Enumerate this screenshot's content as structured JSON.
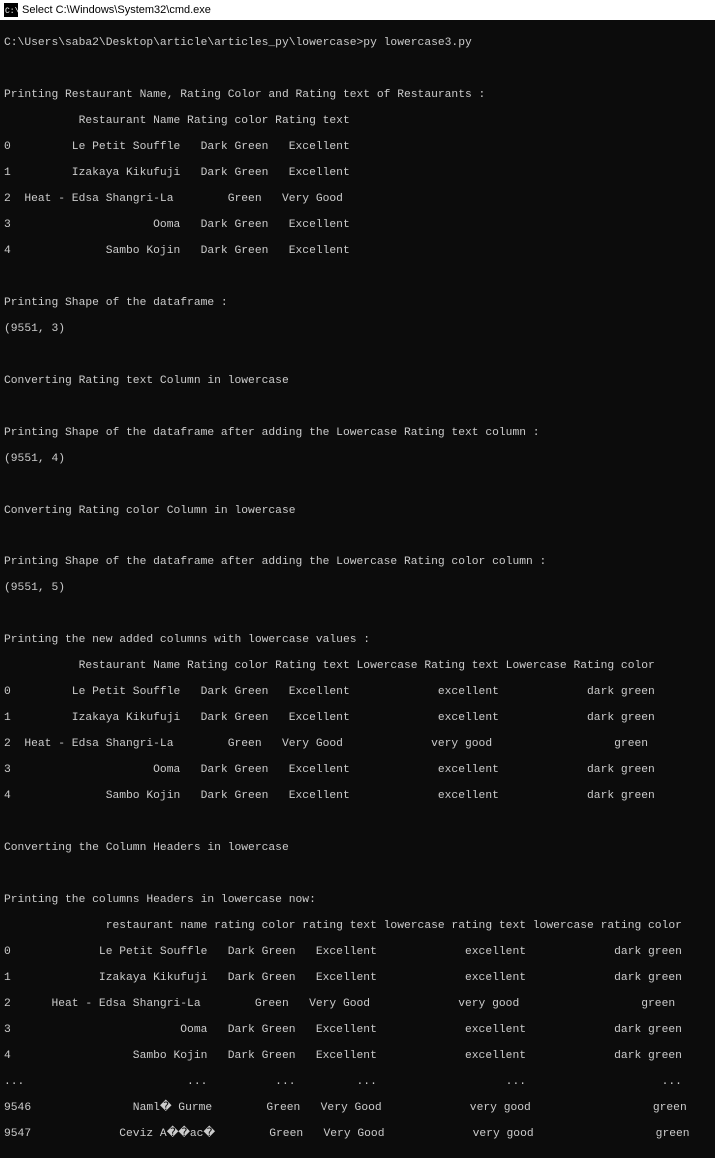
{
  "title_bar": {
    "icon": "cmd-icon",
    "title": "Select C:\\Windows\\System32\\cmd.exe"
  },
  "lines": {
    "l0": "C:\\Users\\saba2\\Desktop\\article\\articles_py\\lowercase>py lowercase3.py",
    "l1": "Printing Restaurant Name, Rating Color and Rating text of Restaurants :",
    "l2": "           Restaurant Name Rating color Rating text",
    "l3": "0         Le Petit Souffle   Dark Green   Excellent",
    "l4": "1         Izakaya Kikufuji   Dark Green   Excellent",
    "l5": "2  Heat - Edsa Shangri-La        Green   Very Good",
    "l6": "3                     Ooma   Dark Green   Excellent",
    "l7": "4              Sambo Kojin   Dark Green   Excellent",
    "l8": "Printing Shape of the dataframe :",
    "l9": "(9551, 3)",
    "l10": "Converting Rating text Column in lowercase",
    "l11": "Printing Shape of the dataframe after adding the Lowercase Rating text column :",
    "l12": "(9551, 4)",
    "l13": "Converting Rating color Column in lowercase",
    "l14": "Printing Shape of the dataframe after adding the Lowercase Rating color column :",
    "l15": "(9551, 5)",
    "l16": "Printing the new added columns with lowercase values :",
    "l17": "           Restaurant Name Rating color Rating text Lowercase Rating text Lowercase Rating color",
    "l18": "0         Le Petit Souffle   Dark Green   Excellent             excellent             dark green",
    "l19": "1         Izakaya Kikufuji   Dark Green   Excellent             excellent             dark green",
    "l20": "2  Heat - Edsa Shangri-La        Green   Very Good             very good                  green",
    "l21": "3                     Ooma   Dark Green   Excellent             excellent             dark green",
    "l22": "4              Sambo Kojin   Dark Green   Excellent             excellent             dark green",
    "l23": "Converting the Column Headers in lowercase",
    "l24": "Printing the columns Headers in lowercase now:",
    "l25": "               restaurant name rating color rating text lowercase rating text lowercase rating color",
    "l26": "0             Le Petit Souffle   Dark Green   Excellent             excellent             dark green",
    "l27": "1             Izakaya Kikufuji   Dark Green   Excellent             excellent             dark green",
    "l28": "2      Heat - Edsa Shangri-La        Green   Very Good             very good                  green",
    "l29": "3                         Ooma   Dark Green   Excellent             excellent             dark green",
    "l30": "4                  Sambo Kojin   Dark Green   Excellent             excellent             dark green",
    "l31": "...                        ...          ...         ...                   ...                    ...",
    "l32": "9546               Naml� Gurme        Green   Very Good             very good                  green",
    "l33": "9547             Ceviz A��ac�        Green   Very Good             very good                  green"
  }
}
